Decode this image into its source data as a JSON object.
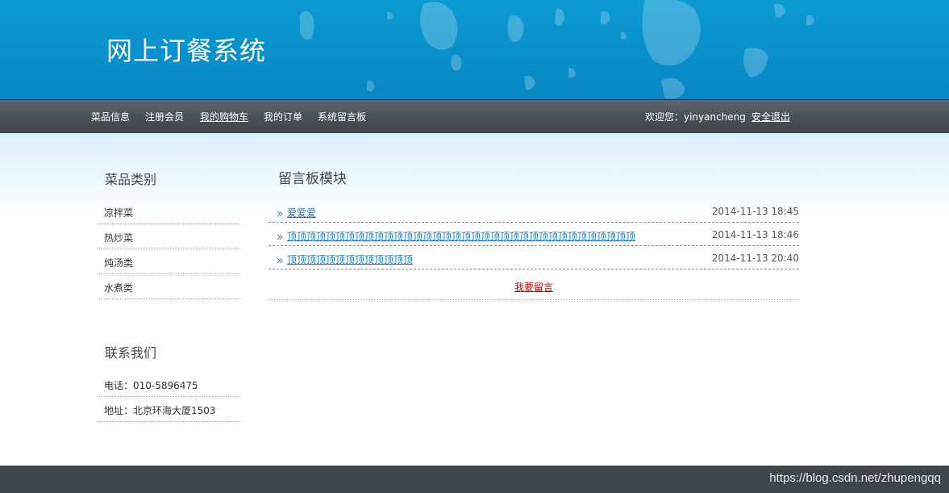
{
  "header": {
    "site_title": "网上订餐系统"
  },
  "nav": {
    "items": [
      {
        "label": "菜品信息"
      },
      {
        "label": "注册会员"
      },
      {
        "label": "我的购物车"
      },
      {
        "label": "我的订单"
      },
      {
        "label": "系统留言板"
      }
    ],
    "welcome_text": "欢迎您：yinyancheng",
    "logout_label": "安全退出"
  },
  "sidebar": {
    "categories_title": "菜品类别",
    "categories": [
      {
        "label": "凉拌菜"
      },
      {
        "label": "热炒菜"
      },
      {
        "label": "炖汤类"
      },
      {
        "label": "水煮类"
      }
    ],
    "contact_title": "联系我们",
    "contact": [
      {
        "label": "电话：010-5896475"
      },
      {
        "label": "地址：北京环海大厦1503"
      }
    ]
  },
  "main": {
    "title": "留言板模块",
    "messages": [
      {
        "title": "爱爱爱",
        "time": "2014-11-13 18:45"
      },
      {
        "title": "顶顶顶顶顶顶顶顶顶顶顶顶顶顶顶顶顶顶顶顶顶顶顶顶顶顶顶顶顶顶顶顶顶顶顶顶",
        "time": "2014-11-13 18:46"
      },
      {
        "title": "顶顶顶顶顶顶顶顶顶顶顶顶顶",
        "time": "2014-11-13 20:40"
      }
    ],
    "leave_message_label": "我要留言"
  },
  "footer": {
    "watermark": "https://blog.csdn.net/zhupengqq"
  },
  "colors": {
    "banner": "#0a8fcb",
    "nav": "#4a5056",
    "link": "#1a78b5",
    "accent_red": "#cc0000",
    "footer": "#3e454b"
  }
}
